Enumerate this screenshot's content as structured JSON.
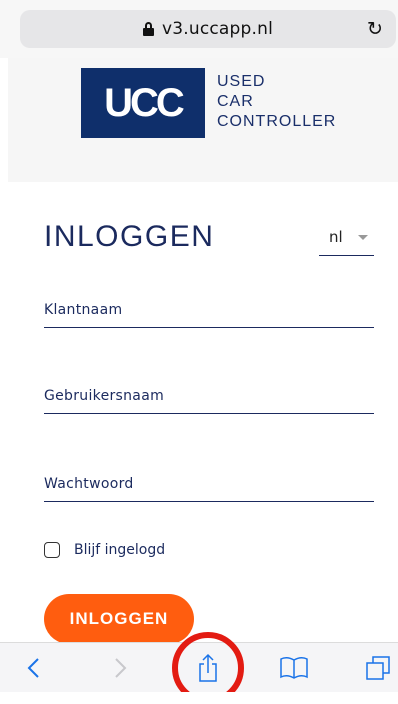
{
  "browser": {
    "url": "v3.uccapp.nl",
    "lock_icon": "lock-icon",
    "reload_icon": "reload-icon"
  },
  "brand": {
    "logo_mark": "UCC",
    "line1": "USED",
    "line2": "CAR",
    "line3": "CONTROLLER",
    "color": "#0f2f6b"
  },
  "login": {
    "title": "INLOGGEN",
    "language": "nl",
    "fields": {
      "customer": "Klantnaam",
      "username": "Gebruikersnaam",
      "password": "Wachtwoord"
    },
    "remember_label": "Blijf ingelogd",
    "remember_checked": false,
    "submit_label": "INLOGGEN",
    "accent_color": "#ff5d0f"
  },
  "toolbar": {
    "icons": [
      "back-icon",
      "forward-icon",
      "share-icon",
      "bookmarks-icon",
      "tabs-icon"
    ],
    "highlight_color": "#e31b12"
  }
}
